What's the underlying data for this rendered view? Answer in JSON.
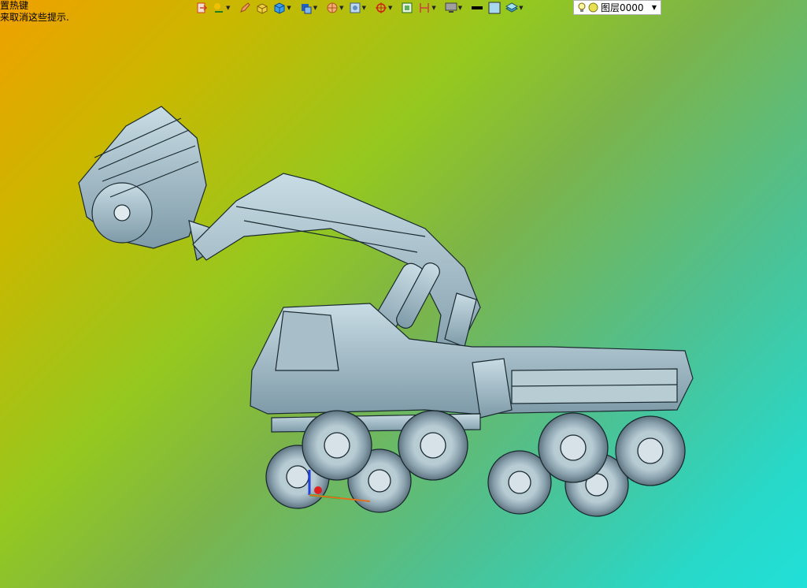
{
  "hint": {
    "line1": "置热键",
    "line2": "来取消这些提示."
  },
  "toolbar": {
    "items": [
      {
        "name": "exit-sketch-icon",
        "color": "#d04020"
      },
      {
        "name": "smart-dimension-icon",
        "color": "#d0a000"
      },
      {
        "name": "pencil-icon",
        "color": "#e06020"
      },
      {
        "name": "extrude-icon",
        "color": "#3aa0d8"
      },
      {
        "name": "box-icon",
        "color": "#1c7ad0"
      },
      {
        "name": "view-orientation-icon",
        "color": "#2060c0"
      },
      {
        "name": "section-view-icon",
        "color": "#d07030"
      },
      {
        "name": "display-style-icon",
        "color": "#6090c0"
      },
      {
        "name": "target-icon",
        "color": "#d02010"
      },
      {
        "name": "zoom-fit-icon",
        "color": "#207020"
      },
      {
        "name": "measure-icon",
        "color": "#d04040"
      },
      {
        "name": "monitor-icon",
        "color": "#606060"
      },
      {
        "name": "line-color-icon",
        "color": "#000000"
      },
      {
        "name": "fill-color-icon",
        "color": "#a8d8f0"
      },
      {
        "name": "layers-icon",
        "color": "#40a0c0"
      }
    ]
  },
  "layer": {
    "value": "图层0000"
  }
}
